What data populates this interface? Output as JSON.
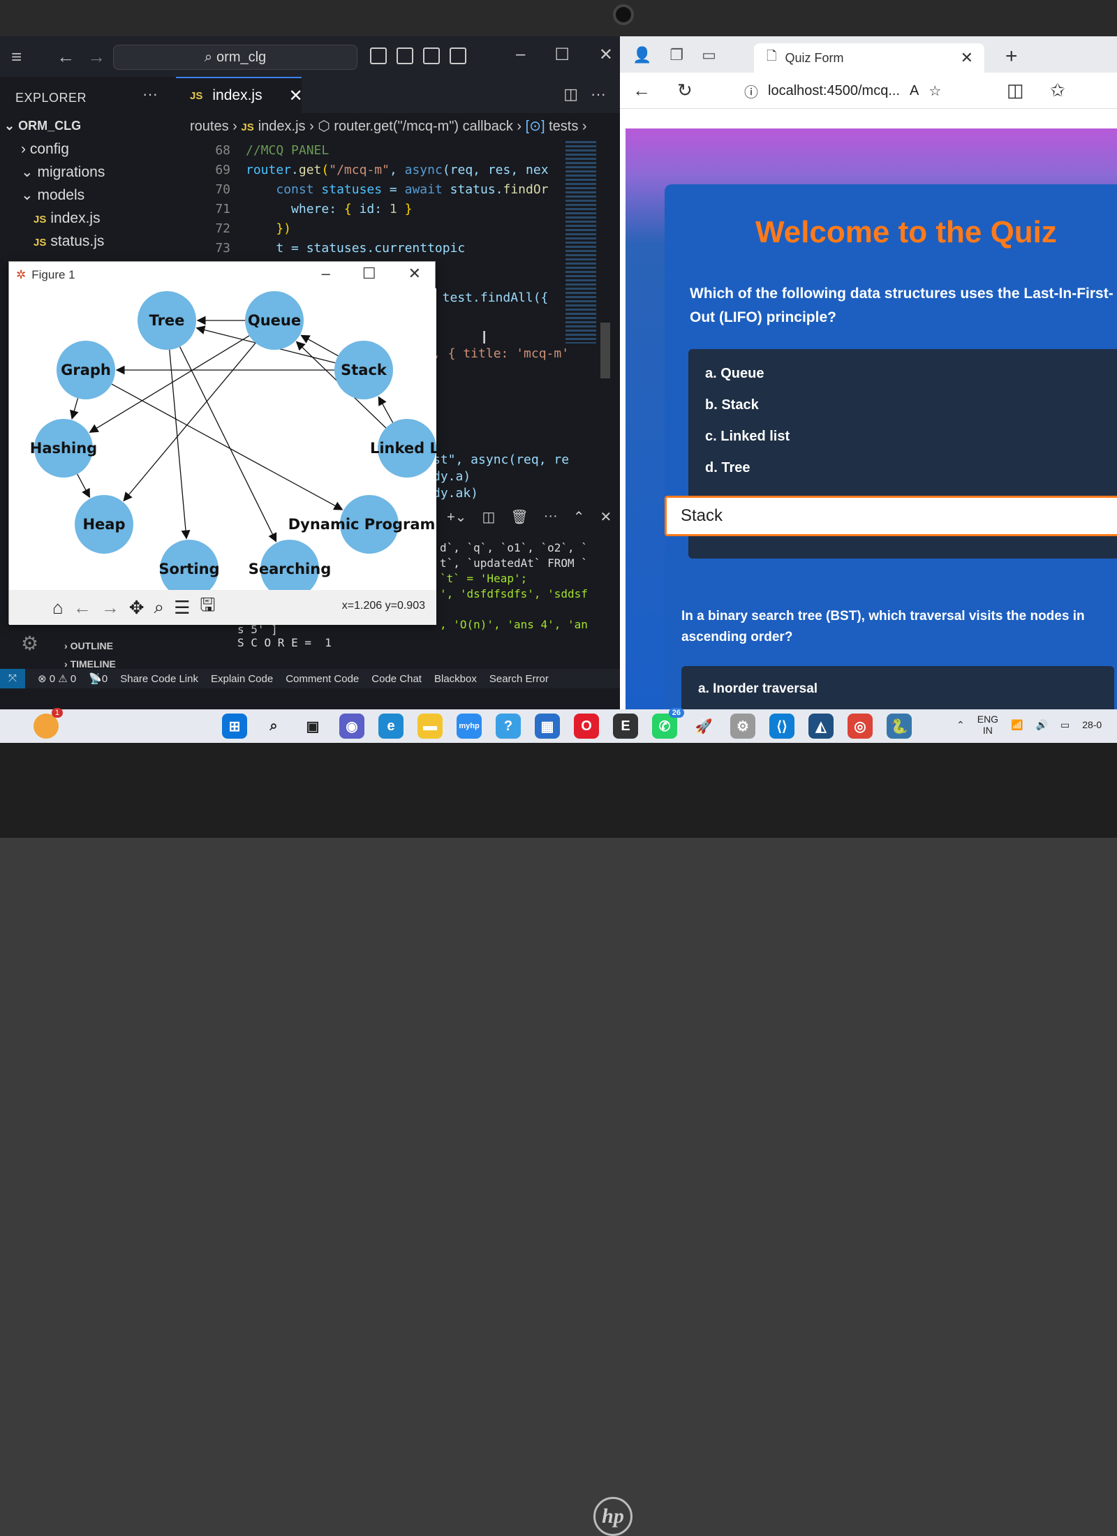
{
  "vscode": {
    "search": "orm_clg",
    "explorer_title": "EXPLORER",
    "project": "ORM_CLG",
    "tree": [
      {
        "label": "config",
        "chevron": "›"
      },
      {
        "label": "migrations",
        "chevron": "⌄"
      },
      {
        "label": "models",
        "chevron": "⌄"
      },
      {
        "label": "index.js",
        "js": true
      },
      {
        "label": "status.js",
        "js": true
      }
    ],
    "tab_label": "index.js",
    "breadcrumb": {
      "folder": "routes",
      "file": "index.js",
      "symbol": "router.get(\"/mcq-m\") callback",
      "var": "tests"
    },
    "line_numbers": [
      "68",
      "69",
      "70",
      "71",
      "72",
      "73"
    ],
    "code_lines": [
      {
        "parts": [
          {
            "t": "//MCQ PANEL",
            "c": "c-com"
          }
        ]
      },
      {
        "parts": [
          {
            "t": "router",
            "c": "c-var"
          },
          {
            "t": ".",
            "c": ""
          },
          {
            "t": "get",
            "c": "c-fn"
          },
          {
            "t": "(",
            "c": "c-pun"
          },
          {
            "t": "\"/mcq-m\"",
            "c": "c-str"
          },
          {
            "t": ", ",
            "c": ""
          },
          {
            "t": "async",
            "c": "c-kw"
          },
          {
            "t": "(req, res, nex",
            "c": ""
          }
        ]
      },
      {
        "parts": [
          {
            "t": "    ",
            "c": ""
          },
          {
            "t": "const",
            "c": "c-kw"
          },
          {
            "t": " ",
            "c": ""
          },
          {
            "t": "statuses",
            "c": "c-var"
          },
          {
            "t": " = ",
            "c": ""
          },
          {
            "t": "await",
            "c": "c-kw"
          },
          {
            "t": " status.",
            "c": ""
          },
          {
            "t": "findOr",
            "c": "c-fn"
          }
        ]
      },
      {
        "parts": [
          {
            "t": "      where: ",
            "c": ""
          },
          {
            "t": "{",
            "c": "c-pun"
          },
          {
            "t": " id: ",
            "c": ""
          },
          {
            "t": "1",
            "c": "c-num"
          },
          {
            "t": " }",
            "c": "c-pun"
          }
        ]
      },
      {
        "parts": [
          {
            "t": "    })",
            "c": "c-pun"
          }
        ]
      },
      {
        "parts": [
          {
            "t": "    t = statuses.currenttopic",
            "c": ""
          }
        ]
      }
    ],
    "code_fragments": {
      "findall": "t test.findAll({",
      "title": ", { title: 'mcq-m'",
      "async": "st\", async(req, re",
      "dya": "dy.a)",
      "dyak": "dy.ak)"
    },
    "terminal_lines": [
      "d`, `q`, `o1`, `o2`, `",
      "t`, `updatedAt` FROM `",
      "`t` = 'Heap';",
      "', 'dsfdfsdfs', 'sddsf",
      "",
      ", 'O(n)', 'ans 4', 'an"
    ],
    "score_lines": [
      "s 5' ]",
      "S C O R E =  1"
    ],
    "outline": "OUTLINE",
    "timeline": "TIMELINE",
    "status": {
      "problems": "⊗ 0 ⚠ 0",
      "ports": "0",
      "items": [
        "Share Code Link",
        "Explain Code",
        "Comment Code",
        "Code Chat",
        "Blackbox",
        "Search Error"
      ]
    }
  },
  "figure": {
    "title": "Figure 1",
    "coords": "x=1.206 y=0.903",
    "node_color": "#6fb7e4",
    "nodes": [
      {
        "label": "Tree"
      },
      {
        "label": "Queue"
      },
      {
        "label": "Graph"
      },
      {
        "label": "Stack"
      },
      {
        "label": "Hashing"
      },
      {
        "label": "Linked Li"
      },
      {
        "label": "Heap"
      },
      {
        "label": "Dynamic Programm"
      },
      {
        "label": "Sorting"
      },
      {
        "label": "Searching"
      }
    ]
  },
  "browser": {
    "tab_title": "Quiz Form",
    "url": "localhost:4500/mcq...",
    "quiz_title": "Welcome to the Quiz",
    "question": "Which of the following data structures uses the Last-In-First-Out (LIFO) principle?",
    "options": [
      "a. Queue",
      "b. Stack",
      "c. Linked list",
      "d. Tree"
    ],
    "answer": "Stack",
    "question2": "In a binary search tree (BST), which traversal visits the nodes in ascending order?",
    "option2_a": "a. Inorder traversal",
    "title_color": "#ff7a1a"
  },
  "taskbar": {
    "weather_badge": "1",
    "whatsapp_badge": "26",
    "lang": "ENG",
    "region": "IN",
    "date_partial": "28-0"
  }
}
